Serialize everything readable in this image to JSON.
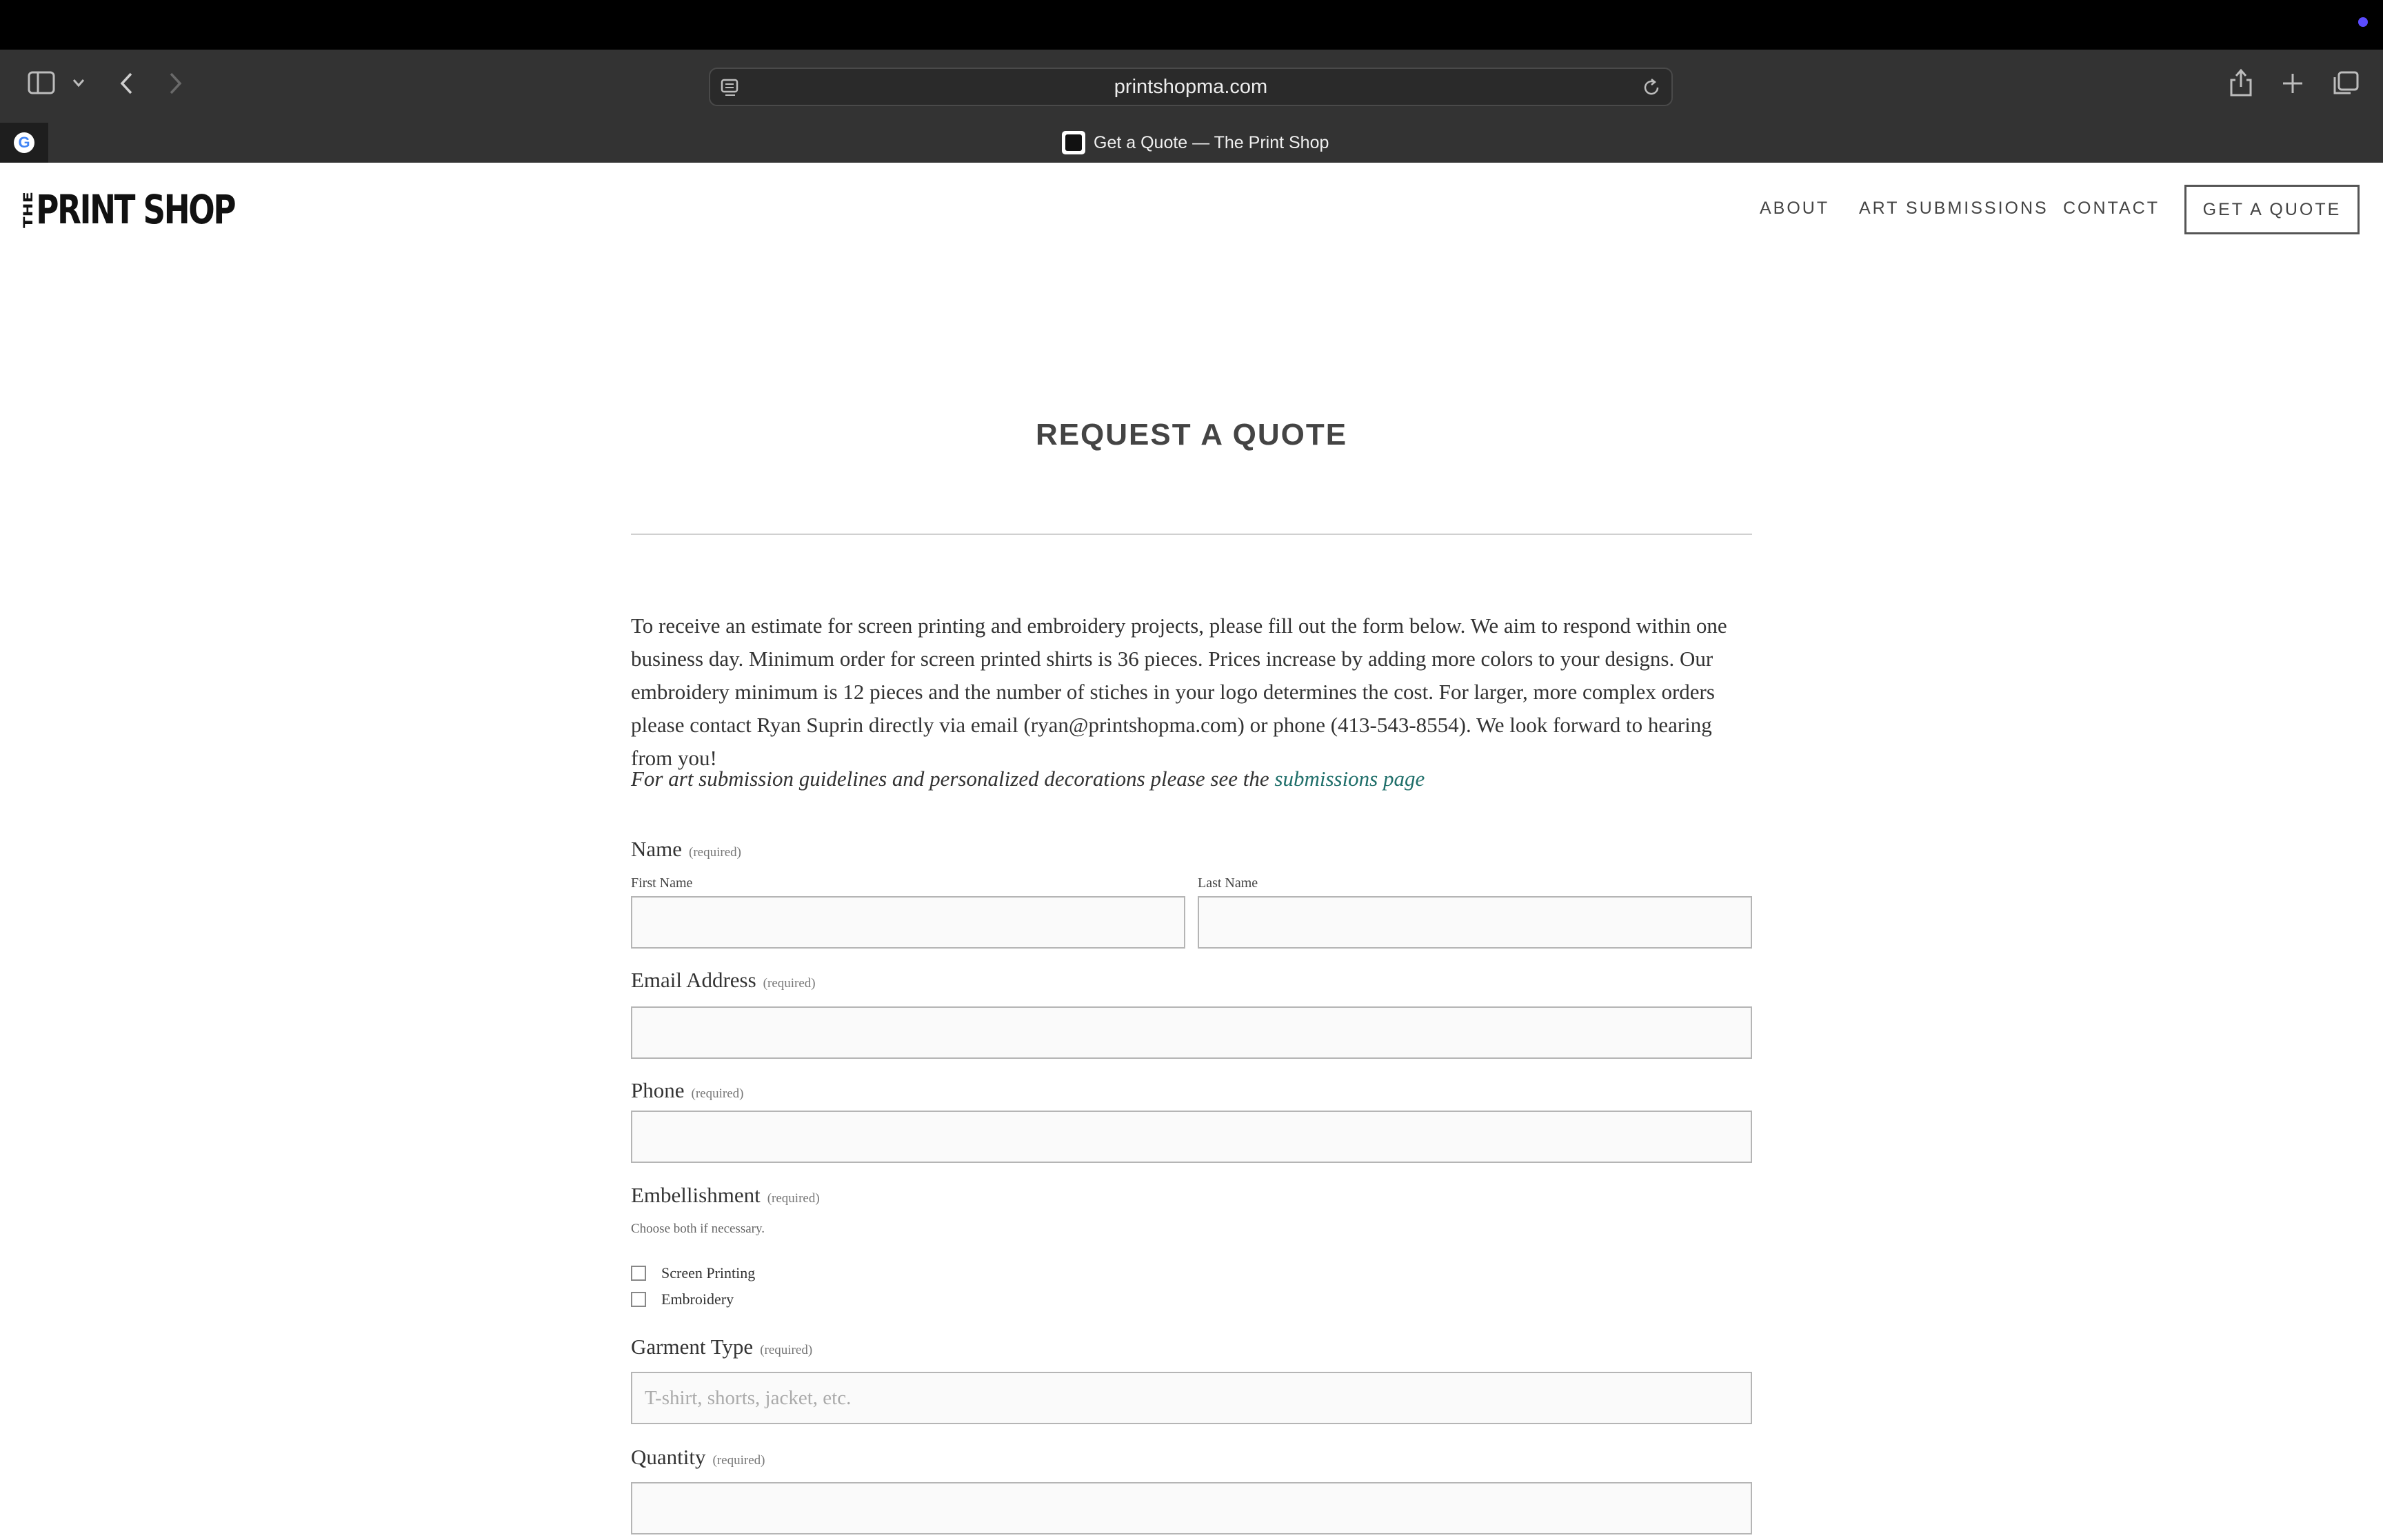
{
  "browser": {
    "url": "printshopma.com",
    "tab_title": "Get a Quote — The Print Shop",
    "google_tab_glyph": "G"
  },
  "site": {
    "logo_text": "PRINT SHOP",
    "logo_mark": "THE",
    "nav": [
      "ABOUT",
      "ART SUBMISSIONS",
      "CONTACT"
    ],
    "cta": "GET A QUOTE"
  },
  "content": {
    "title": "REQUEST A QUOTE",
    "intro": "To receive an estimate for screen printing and embroidery projects, please fill out the form below. We aim to respond within one business day. Minimum order for screen printed shirts is 36 pieces. Prices increase by adding more colors to your designs. Our embroidery minimum is 12 pieces and the number of stiches in your logo determines the cost.  For larger, more complex orders please contact Ryan Suprin directly via email (ryan@printshopma.com) or phone (413-543-8554). We look forward to hearing from you!",
    "art_note_prefix": "For art submission guidelines and personalized decorations please see the ",
    "art_note_link": "submissions page"
  },
  "form": {
    "required_tag": "(required)",
    "name_label": "Name",
    "first_name_label": "First Name",
    "last_name_label": "Last Name",
    "email_label": "Email Address",
    "phone_label": "Phone",
    "embellishment_label": "Embellishment",
    "embellishment_hint": "Choose both if necessary.",
    "embellishment_options": [
      "Screen Printing",
      "Embroidery"
    ],
    "garment_label": "Garment Type",
    "garment_placeholder": "T-shirt, shorts, jacket, etc.",
    "quantity_label": "Quantity"
  },
  "icons": [
    "sidebar-icon",
    "chevron-down-icon",
    "back-icon",
    "forward-icon",
    "reader-icon",
    "reload-icon",
    "share-icon",
    "new-tab-icon",
    "tabs-overview-icon"
  ],
  "colors": {
    "link": "#1f6f6a",
    "chrome": "#333333",
    "text": "#333333"
  }
}
